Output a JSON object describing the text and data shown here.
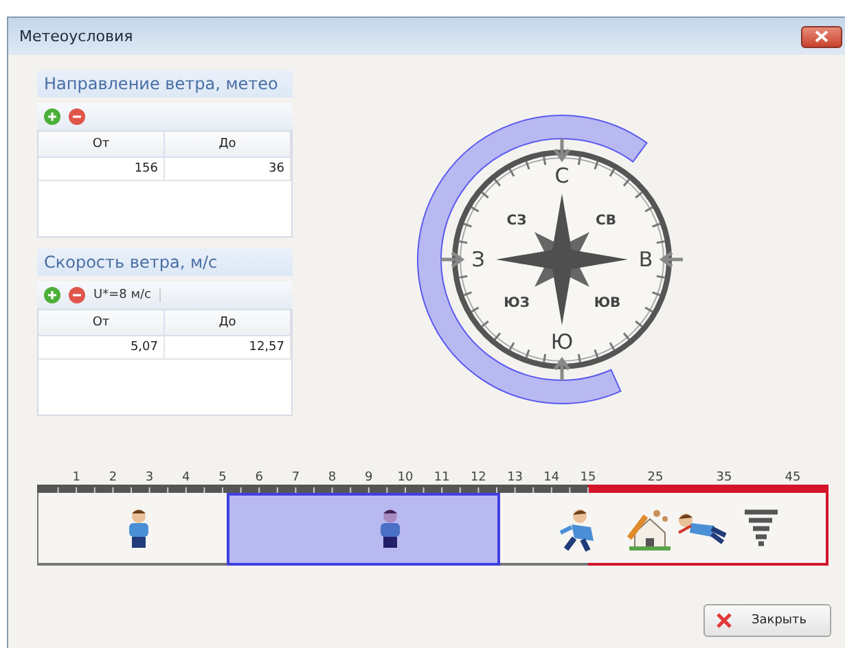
{
  "window": {
    "title": "Метеоусловия"
  },
  "direction_panel": {
    "title": "Направление ветра, метео",
    "columns": [
      "От",
      "До"
    ],
    "rows": [
      [
        "156",
        "36"
      ]
    ]
  },
  "speed_panel": {
    "title": "Скорость ветра, м/с",
    "toolbar_label": "U*=8 м/с",
    "columns": [
      "От",
      "До"
    ],
    "rows": [
      [
        "5,07",
        "12,57"
      ]
    ]
  },
  "compass": {
    "cardinal": [
      "С",
      "В",
      "Ю",
      "З"
    ],
    "intercardinal": [
      "СЗ",
      "СВ",
      "ЮЗ",
      "ЮВ"
    ]
  },
  "scale": {
    "ticks": [
      "1",
      "2",
      "3",
      "4",
      "5",
      "6",
      "7",
      "8",
      "9",
      "10",
      "11",
      "12",
      "13",
      "14",
      "15"
    ],
    "storm_ticks": [
      "25",
      "35",
      "45"
    ]
  },
  "close_button": "Закрыть"
}
